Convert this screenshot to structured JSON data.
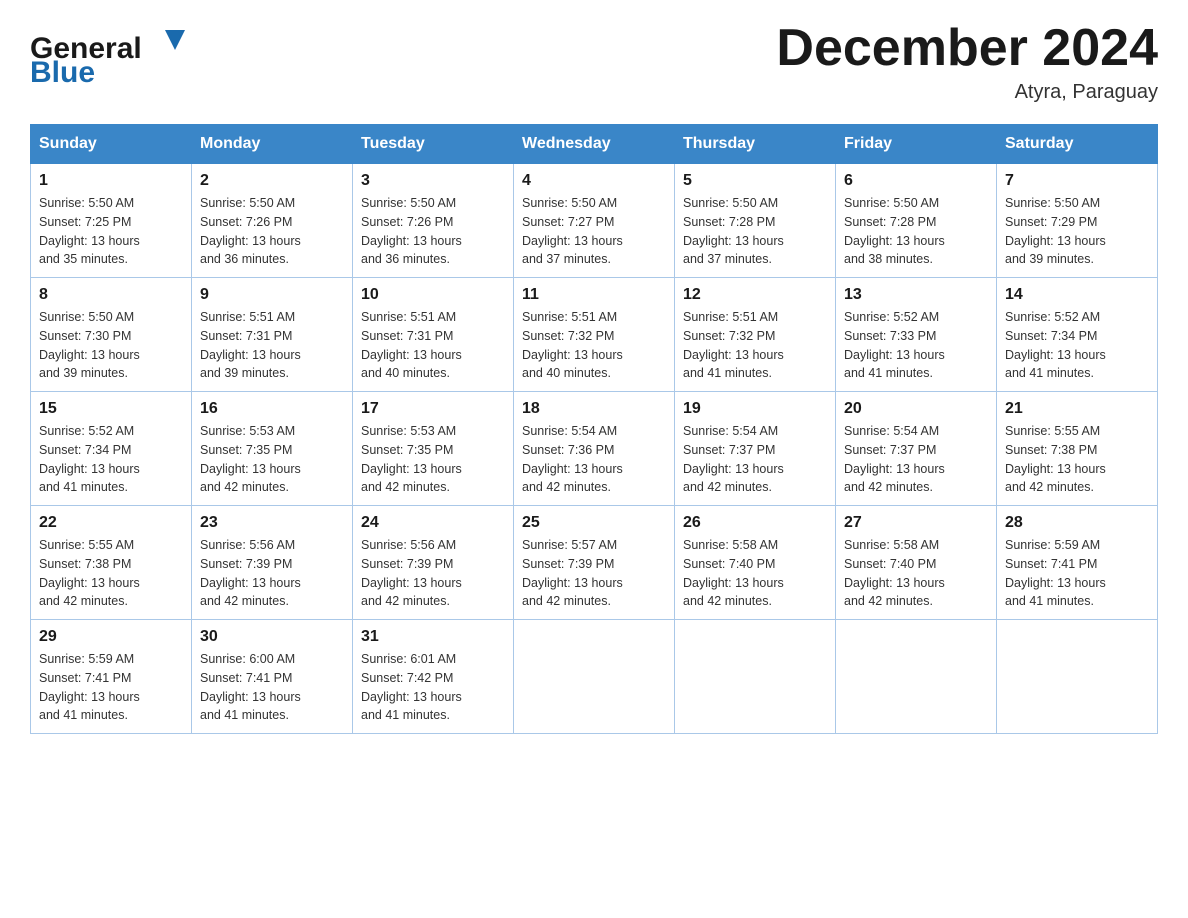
{
  "header": {
    "logo_general": "General",
    "logo_blue": "Blue",
    "month_title": "December 2024",
    "location": "Atyra, Paraguay"
  },
  "weekdays": [
    "Sunday",
    "Monday",
    "Tuesday",
    "Wednesday",
    "Thursday",
    "Friday",
    "Saturday"
  ],
  "weeks": [
    [
      {
        "day": "1",
        "sunrise": "5:50 AM",
        "sunset": "7:25 PM",
        "daylight": "13 hours and 35 minutes."
      },
      {
        "day": "2",
        "sunrise": "5:50 AM",
        "sunset": "7:26 PM",
        "daylight": "13 hours and 36 minutes."
      },
      {
        "day": "3",
        "sunrise": "5:50 AM",
        "sunset": "7:26 PM",
        "daylight": "13 hours and 36 minutes."
      },
      {
        "day": "4",
        "sunrise": "5:50 AM",
        "sunset": "7:27 PM",
        "daylight": "13 hours and 37 minutes."
      },
      {
        "day": "5",
        "sunrise": "5:50 AM",
        "sunset": "7:28 PM",
        "daylight": "13 hours and 37 minutes."
      },
      {
        "day": "6",
        "sunrise": "5:50 AM",
        "sunset": "7:28 PM",
        "daylight": "13 hours and 38 minutes."
      },
      {
        "day": "7",
        "sunrise": "5:50 AM",
        "sunset": "7:29 PM",
        "daylight": "13 hours and 39 minutes."
      }
    ],
    [
      {
        "day": "8",
        "sunrise": "5:50 AM",
        "sunset": "7:30 PM",
        "daylight": "13 hours and 39 minutes."
      },
      {
        "day": "9",
        "sunrise": "5:51 AM",
        "sunset": "7:31 PM",
        "daylight": "13 hours and 39 minutes."
      },
      {
        "day": "10",
        "sunrise": "5:51 AM",
        "sunset": "7:31 PM",
        "daylight": "13 hours and 40 minutes."
      },
      {
        "day": "11",
        "sunrise": "5:51 AM",
        "sunset": "7:32 PM",
        "daylight": "13 hours and 40 minutes."
      },
      {
        "day": "12",
        "sunrise": "5:51 AM",
        "sunset": "7:32 PM",
        "daylight": "13 hours and 41 minutes."
      },
      {
        "day": "13",
        "sunrise": "5:52 AM",
        "sunset": "7:33 PM",
        "daylight": "13 hours and 41 minutes."
      },
      {
        "day": "14",
        "sunrise": "5:52 AM",
        "sunset": "7:34 PM",
        "daylight": "13 hours and 41 minutes."
      }
    ],
    [
      {
        "day": "15",
        "sunrise": "5:52 AM",
        "sunset": "7:34 PM",
        "daylight": "13 hours and 41 minutes."
      },
      {
        "day": "16",
        "sunrise": "5:53 AM",
        "sunset": "7:35 PM",
        "daylight": "13 hours and 42 minutes."
      },
      {
        "day": "17",
        "sunrise": "5:53 AM",
        "sunset": "7:35 PM",
        "daylight": "13 hours and 42 minutes."
      },
      {
        "day": "18",
        "sunrise": "5:54 AM",
        "sunset": "7:36 PM",
        "daylight": "13 hours and 42 minutes."
      },
      {
        "day": "19",
        "sunrise": "5:54 AM",
        "sunset": "7:37 PM",
        "daylight": "13 hours and 42 minutes."
      },
      {
        "day": "20",
        "sunrise": "5:54 AM",
        "sunset": "7:37 PM",
        "daylight": "13 hours and 42 minutes."
      },
      {
        "day": "21",
        "sunrise": "5:55 AM",
        "sunset": "7:38 PM",
        "daylight": "13 hours and 42 minutes."
      }
    ],
    [
      {
        "day": "22",
        "sunrise": "5:55 AM",
        "sunset": "7:38 PM",
        "daylight": "13 hours and 42 minutes."
      },
      {
        "day": "23",
        "sunrise": "5:56 AM",
        "sunset": "7:39 PM",
        "daylight": "13 hours and 42 minutes."
      },
      {
        "day": "24",
        "sunrise": "5:56 AM",
        "sunset": "7:39 PM",
        "daylight": "13 hours and 42 minutes."
      },
      {
        "day": "25",
        "sunrise": "5:57 AM",
        "sunset": "7:39 PM",
        "daylight": "13 hours and 42 minutes."
      },
      {
        "day": "26",
        "sunrise": "5:58 AM",
        "sunset": "7:40 PM",
        "daylight": "13 hours and 42 minutes."
      },
      {
        "day": "27",
        "sunrise": "5:58 AM",
        "sunset": "7:40 PM",
        "daylight": "13 hours and 42 minutes."
      },
      {
        "day": "28",
        "sunrise": "5:59 AM",
        "sunset": "7:41 PM",
        "daylight": "13 hours and 41 minutes."
      }
    ],
    [
      {
        "day": "29",
        "sunrise": "5:59 AM",
        "sunset": "7:41 PM",
        "daylight": "13 hours and 41 minutes."
      },
      {
        "day": "30",
        "sunrise": "6:00 AM",
        "sunset": "7:41 PM",
        "daylight": "13 hours and 41 minutes."
      },
      {
        "day": "31",
        "sunrise": "6:01 AM",
        "sunset": "7:42 PM",
        "daylight": "13 hours and 41 minutes."
      },
      null,
      null,
      null,
      null
    ]
  ],
  "labels": {
    "sunrise": "Sunrise:",
    "sunset": "Sunset:",
    "daylight": "Daylight:"
  }
}
